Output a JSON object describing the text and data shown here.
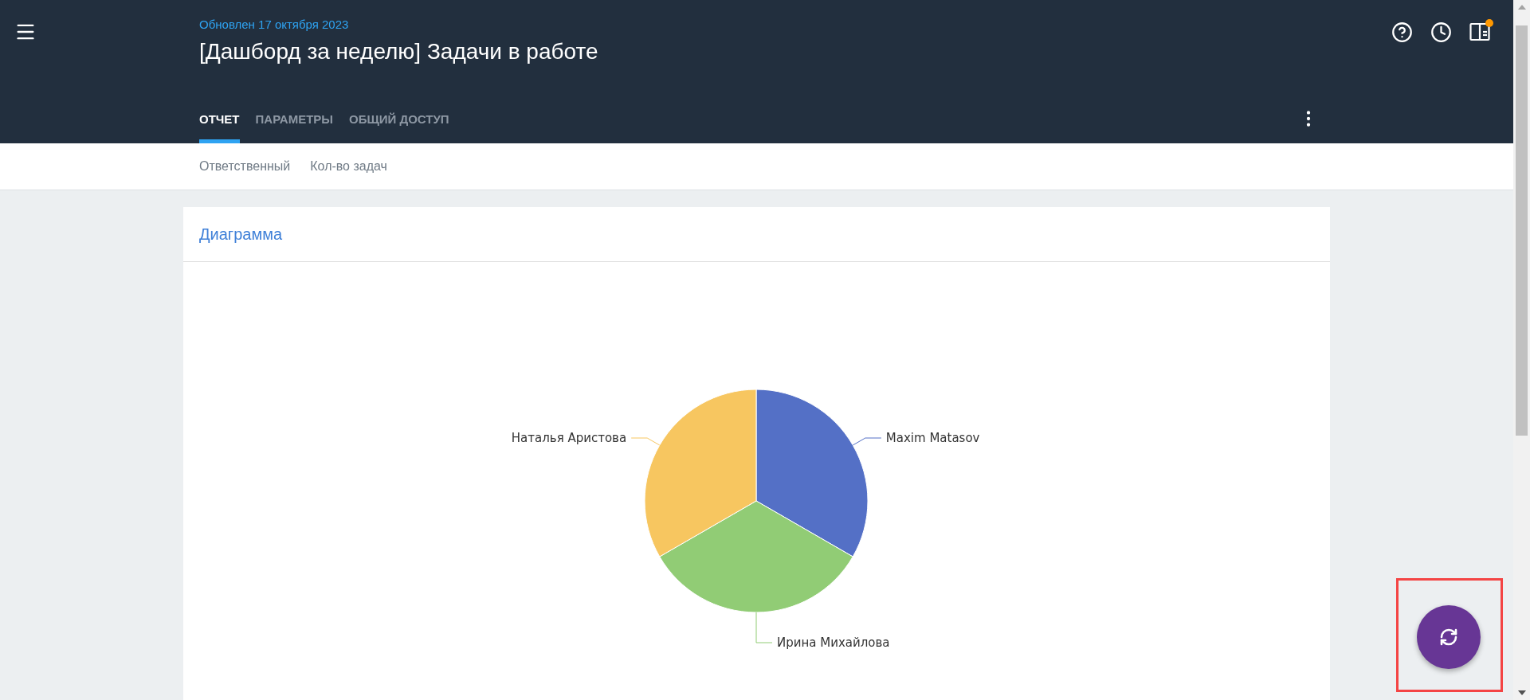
{
  "header": {
    "updated": "Обновлен 17 октября 2023",
    "title": "[Дашборд за неделю] Задачи в работе",
    "notification_dot": true
  },
  "tabs": [
    {
      "label": "ОТЧЕТ",
      "selected": true
    },
    {
      "label": "ПАРАМЕТРЫ",
      "selected": false
    },
    {
      "label": "ОБЩИЙ ДОСТУП",
      "selected": false
    }
  ],
  "fields": [
    "Ответственный",
    "Кол-во задач"
  ],
  "card": {
    "title": "Диаграмма",
    "pie": {
      "slices": [
        {
          "label": "Maxim Matasov",
          "color": "#5470c6"
        },
        {
          "label": "Ирина Михайлова",
          "color": "#91cc75"
        },
        {
          "label": "Наталья Аристова",
          "color": "#f7c660"
        }
      ]
    }
  }
}
